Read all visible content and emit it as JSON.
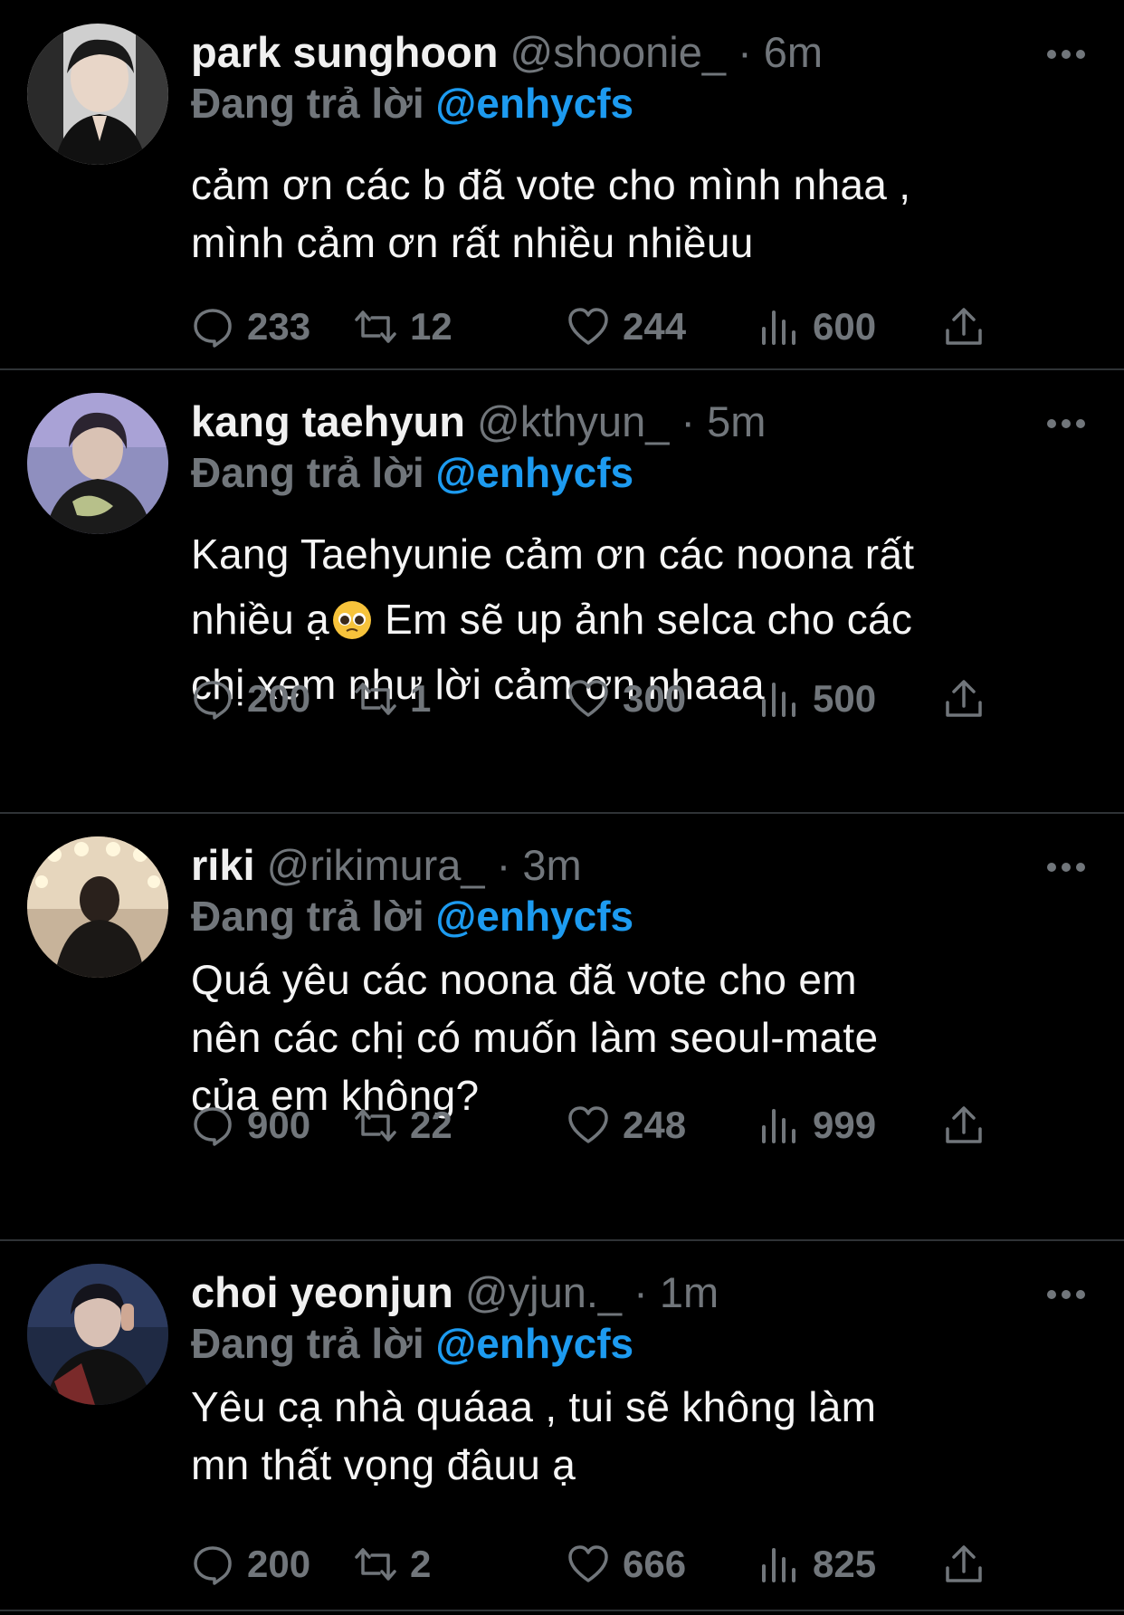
{
  "reply_prefix": "Đang trả lời",
  "tweets": [
    {
      "name": "park sunghoon",
      "handle": "@shoonie_",
      "time": "6m",
      "reply_to": "@enhycfs",
      "text": "cảm ơn các b đã vote cho mình nhaa ,\nmình cảm ơn rất nhiều nhiềuu",
      "replies": "233",
      "retweets": "12",
      "likes": "244",
      "views": "600"
    },
    {
      "name": "kang taehyun",
      "handle": "@kthyun_",
      "time": "5m",
      "reply_to": "@enhycfs",
      "text_a": "Kang Taehyunie cảm ơn các noona rất\nnhiều ạ",
      "text_b": " Em sẽ up ảnh selca cho các\nchị xem như lời cảm ơn nhaaa",
      "emoji": "pleading-face",
      "replies": "200",
      "retweets": "1",
      "likes": "300",
      "views": "500"
    },
    {
      "name": "riki",
      "handle": "@rikimura_",
      "time": "3m",
      "reply_to": "@enhycfs",
      "text": "Quá yêu các noona đã vote cho em\nnên các chị có muốn làm seoul-mate\ncủa em không?",
      "replies": "900",
      "retweets": "22",
      "likes": "248",
      "views": "999"
    },
    {
      "name": "choi yeonjun",
      "handle": "@yjun._",
      "time": "1m",
      "reply_to": "@enhycfs",
      "text": "Yêu cạ nhà quáaa , tui sẽ không làm\nmn thất vọng đâuu ạ",
      "replies": "200",
      "retweets": "2",
      "likes": "666",
      "views": "825"
    }
  ],
  "colors": {
    "background": "#000000",
    "muted": "#71767b",
    "mention": "#1d9bf0",
    "divider": "#2f3336"
  }
}
